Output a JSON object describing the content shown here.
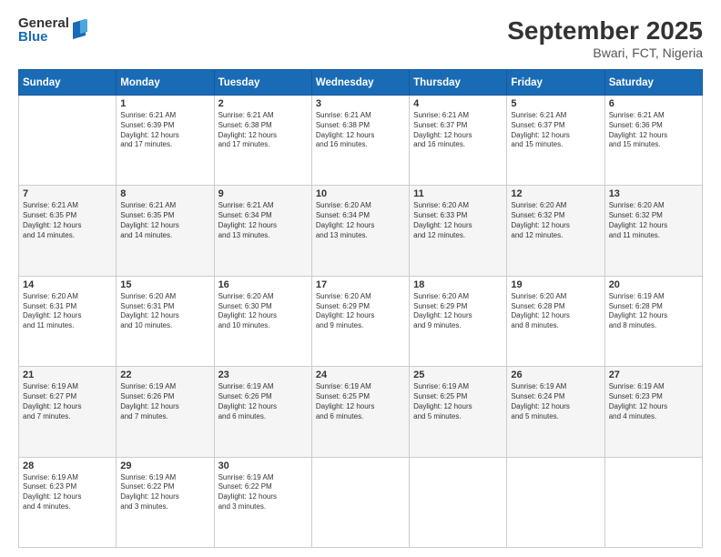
{
  "header": {
    "logo_general": "General",
    "logo_blue": "Blue",
    "month_title": "September 2025",
    "location": "Bwari, FCT, Nigeria"
  },
  "days_of_week": [
    "Sunday",
    "Monday",
    "Tuesday",
    "Wednesday",
    "Thursday",
    "Friday",
    "Saturday"
  ],
  "weeks": [
    [
      {
        "day": "",
        "info": ""
      },
      {
        "day": "1",
        "info": "Sunrise: 6:21 AM\nSunset: 6:39 PM\nDaylight: 12 hours\nand 17 minutes."
      },
      {
        "day": "2",
        "info": "Sunrise: 6:21 AM\nSunset: 6:38 PM\nDaylight: 12 hours\nand 17 minutes."
      },
      {
        "day": "3",
        "info": "Sunrise: 6:21 AM\nSunset: 6:38 PM\nDaylight: 12 hours\nand 16 minutes."
      },
      {
        "day": "4",
        "info": "Sunrise: 6:21 AM\nSunset: 6:37 PM\nDaylight: 12 hours\nand 16 minutes."
      },
      {
        "day": "5",
        "info": "Sunrise: 6:21 AM\nSunset: 6:37 PM\nDaylight: 12 hours\nand 15 minutes."
      },
      {
        "day": "6",
        "info": "Sunrise: 6:21 AM\nSunset: 6:36 PM\nDaylight: 12 hours\nand 15 minutes."
      }
    ],
    [
      {
        "day": "7",
        "info": "Sunrise: 6:21 AM\nSunset: 6:35 PM\nDaylight: 12 hours\nand 14 minutes."
      },
      {
        "day": "8",
        "info": "Sunrise: 6:21 AM\nSunset: 6:35 PM\nDaylight: 12 hours\nand 14 minutes."
      },
      {
        "day": "9",
        "info": "Sunrise: 6:21 AM\nSunset: 6:34 PM\nDaylight: 12 hours\nand 13 minutes."
      },
      {
        "day": "10",
        "info": "Sunrise: 6:20 AM\nSunset: 6:34 PM\nDaylight: 12 hours\nand 13 minutes."
      },
      {
        "day": "11",
        "info": "Sunrise: 6:20 AM\nSunset: 6:33 PM\nDaylight: 12 hours\nand 12 minutes."
      },
      {
        "day": "12",
        "info": "Sunrise: 6:20 AM\nSunset: 6:32 PM\nDaylight: 12 hours\nand 12 minutes."
      },
      {
        "day": "13",
        "info": "Sunrise: 6:20 AM\nSunset: 6:32 PM\nDaylight: 12 hours\nand 11 minutes."
      }
    ],
    [
      {
        "day": "14",
        "info": "Sunrise: 6:20 AM\nSunset: 6:31 PM\nDaylight: 12 hours\nand 11 minutes."
      },
      {
        "day": "15",
        "info": "Sunrise: 6:20 AM\nSunset: 6:31 PM\nDaylight: 12 hours\nand 10 minutes."
      },
      {
        "day": "16",
        "info": "Sunrise: 6:20 AM\nSunset: 6:30 PM\nDaylight: 12 hours\nand 10 minutes."
      },
      {
        "day": "17",
        "info": "Sunrise: 6:20 AM\nSunset: 6:29 PM\nDaylight: 12 hours\nand 9 minutes."
      },
      {
        "day": "18",
        "info": "Sunrise: 6:20 AM\nSunset: 6:29 PM\nDaylight: 12 hours\nand 9 minutes."
      },
      {
        "day": "19",
        "info": "Sunrise: 6:20 AM\nSunset: 6:28 PM\nDaylight: 12 hours\nand 8 minutes."
      },
      {
        "day": "20",
        "info": "Sunrise: 6:19 AM\nSunset: 6:28 PM\nDaylight: 12 hours\nand 8 minutes."
      }
    ],
    [
      {
        "day": "21",
        "info": "Sunrise: 6:19 AM\nSunset: 6:27 PM\nDaylight: 12 hours\nand 7 minutes."
      },
      {
        "day": "22",
        "info": "Sunrise: 6:19 AM\nSunset: 6:26 PM\nDaylight: 12 hours\nand 7 minutes."
      },
      {
        "day": "23",
        "info": "Sunrise: 6:19 AM\nSunset: 6:26 PM\nDaylight: 12 hours\nand 6 minutes."
      },
      {
        "day": "24",
        "info": "Sunrise: 6:19 AM\nSunset: 6:25 PM\nDaylight: 12 hours\nand 6 minutes."
      },
      {
        "day": "25",
        "info": "Sunrise: 6:19 AM\nSunset: 6:25 PM\nDaylight: 12 hours\nand 5 minutes."
      },
      {
        "day": "26",
        "info": "Sunrise: 6:19 AM\nSunset: 6:24 PM\nDaylight: 12 hours\nand 5 minutes."
      },
      {
        "day": "27",
        "info": "Sunrise: 6:19 AM\nSunset: 6:23 PM\nDaylight: 12 hours\nand 4 minutes."
      }
    ],
    [
      {
        "day": "28",
        "info": "Sunrise: 6:19 AM\nSunset: 6:23 PM\nDaylight: 12 hours\nand 4 minutes."
      },
      {
        "day": "29",
        "info": "Sunrise: 6:19 AM\nSunset: 6:22 PM\nDaylight: 12 hours\nand 3 minutes."
      },
      {
        "day": "30",
        "info": "Sunrise: 6:19 AM\nSunset: 6:22 PM\nDaylight: 12 hours\nand 3 minutes."
      },
      {
        "day": "",
        "info": ""
      },
      {
        "day": "",
        "info": ""
      },
      {
        "day": "",
        "info": ""
      },
      {
        "day": "",
        "info": ""
      }
    ]
  ]
}
